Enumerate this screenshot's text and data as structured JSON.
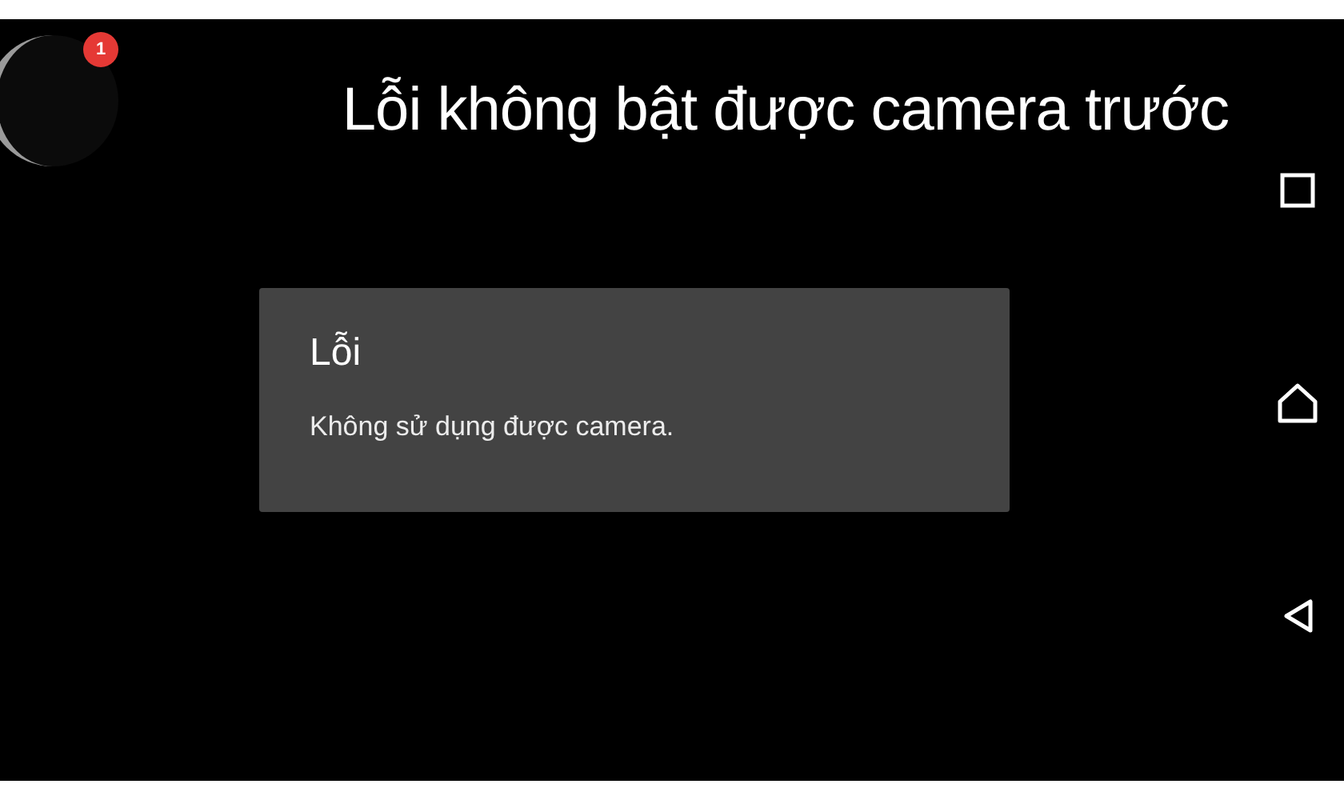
{
  "caption": "Lỗi không bật được camera trước",
  "floating_bubble": {
    "badge": "1"
  },
  "dialog": {
    "title": "Lỗi",
    "message": "Không sử dụng được camera."
  },
  "nav_bar": [
    {
      "kind": "recents"
    },
    {
      "kind": "home"
    },
    {
      "kind": "back"
    }
  ]
}
